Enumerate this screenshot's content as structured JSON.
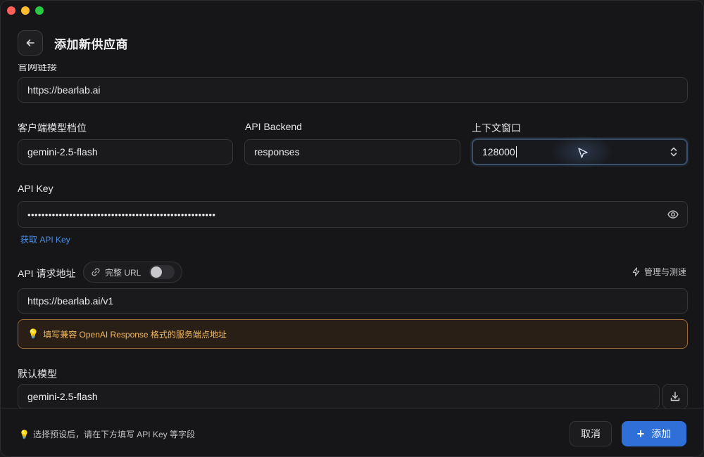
{
  "window": {
    "title": "添加新供应商"
  },
  "fields": {
    "website": {
      "label": "官网链接",
      "value": "https://bearlab.ai"
    },
    "client_model_tier": {
      "label": "客户端模型档位",
      "value": "gemini-2.5-flash"
    },
    "api_backend": {
      "label": "API Backend",
      "value": "responses"
    },
    "context_window": {
      "label": "上下文窗口",
      "value": "128000"
    },
    "api_key": {
      "label": "API Key",
      "value": "••••••••••••••••••••••••••••••••••••••••••••••••••••••",
      "get_link": "获取 API Key"
    },
    "api_url": {
      "label": "API 请求地址",
      "full_url_toggle": "完整 URL",
      "full_url_enabled": false,
      "manage_label": "管理与测速",
      "value": "https://bearlab.ai/v1",
      "hint": "填写兼容 OpenAI Response 格式的服务端点地址"
    },
    "default_model": {
      "label": "默认模型",
      "value": "gemini-2.5-flash"
    }
  },
  "footer": {
    "hint": "选择预设后，请在下方填写 API Key 等字段",
    "cancel_label": "取消",
    "add_label": "添加"
  },
  "colors": {
    "accent": "#2f6fd8",
    "link": "#4d8fe8",
    "warning_text": "#f0b860",
    "warning_border": "#9a6a3a"
  }
}
